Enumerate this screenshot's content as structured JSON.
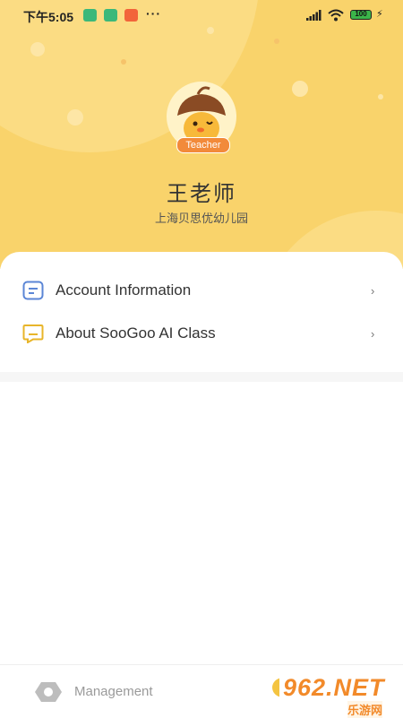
{
  "status_bar": {
    "time": "下午5:05",
    "more": "···",
    "battery": "100"
  },
  "profile": {
    "badge": "Teacher",
    "name": "王老师",
    "school": "上海贝思优幼儿园"
  },
  "menu": [
    {
      "label": "Account Information",
      "icon": "document-icon",
      "chevron": "›"
    },
    {
      "label": "About SooGoo AI Class",
      "icon": "chat-bubble-icon",
      "chevron": "›"
    }
  ],
  "tab_bar": {
    "management_label": "Management"
  },
  "watermark": {
    "top": "962.NET",
    "bottom": "乐游网"
  },
  "colors": {
    "hero": "#f9d36b",
    "accent": "#f28a3a",
    "icon_blue": "#5b86d6",
    "icon_yellow": "#e8b52a"
  }
}
